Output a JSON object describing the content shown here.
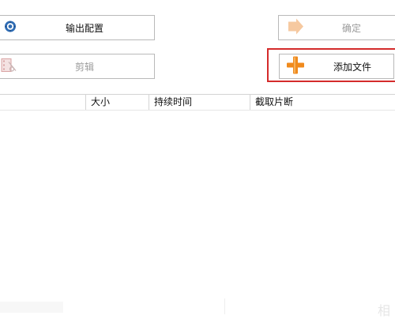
{
  "toolbar": {
    "output_config": "输出配置",
    "confirm": "确定",
    "edit": "剪辑",
    "add_file": "添加文件"
  },
  "table": {
    "columns": [
      "",
      "大小",
      "持续时间",
      "截取片断"
    ]
  },
  "footer": {
    "partial_char": "相"
  },
  "colors": {
    "highlight": "#d42b2b",
    "add_icon": "#f08a1c",
    "disabled_text": "#9b9b9b"
  },
  "icons": [
    "gear-icon",
    "arrow-right-icon",
    "film-cut-icon",
    "plus-icon"
  ]
}
